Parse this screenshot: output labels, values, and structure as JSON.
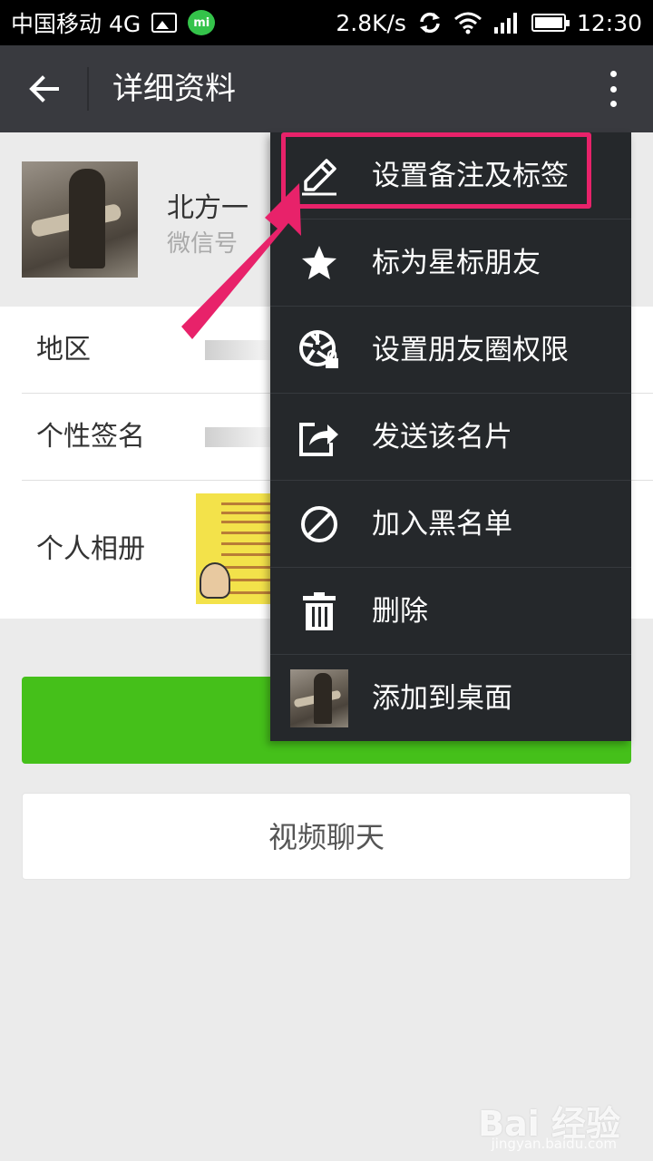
{
  "status_bar": {
    "carrier": "中国移动 4G",
    "speed": "2.8K/s",
    "time": "12:30",
    "icons": [
      "image-icon",
      "mi-message-icon",
      "sync-icon",
      "wifi-icon",
      "signal-icon",
      "battery-icon"
    ]
  },
  "header": {
    "title": "详细资料",
    "back_icon": "arrow-left-icon",
    "more_icon": "more-vertical-icon"
  },
  "profile": {
    "nickname": "北方一",
    "wechat_id_label": "微信号"
  },
  "info": {
    "region_label": "地区",
    "signature_label": "个性签名",
    "album_label": "个人相册"
  },
  "buttons": {
    "video_chat": "视频聊天"
  },
  "menu": {
    "items": [
      {
        "label": "设置备注及标签",
        "icon": "pencil-icon"
      },
      {
        "label": "标为星标朋友",
        "icon": "star-icon"
      },
      {
        "label": "设置朋友圈权限",
        "icon": "moments-lock-icon"
      },
      {
        "label": "发送该名片",
        "icon": "share-icon"
      },
      {
        "label": "加入黑名单",
        "icon": "block-icon"
      },
      {
        "label": "删除",
        "icon": "trash-icon"
      },
      {
        "label": "添加到桌面",
        "icon": "avatar-thumbnail"
      }
    ],
    "highlight_color": "#e8226a"
  },
  "colors": {
    "header_bg": "#393a3f",
    "menu_bg": "#25282b",
    "accent_green": "#45c01a"
  },
  "watermark": {
    "text": "Bai 经验",
    "sub": "jingyan.baidu.com"
  }
}
